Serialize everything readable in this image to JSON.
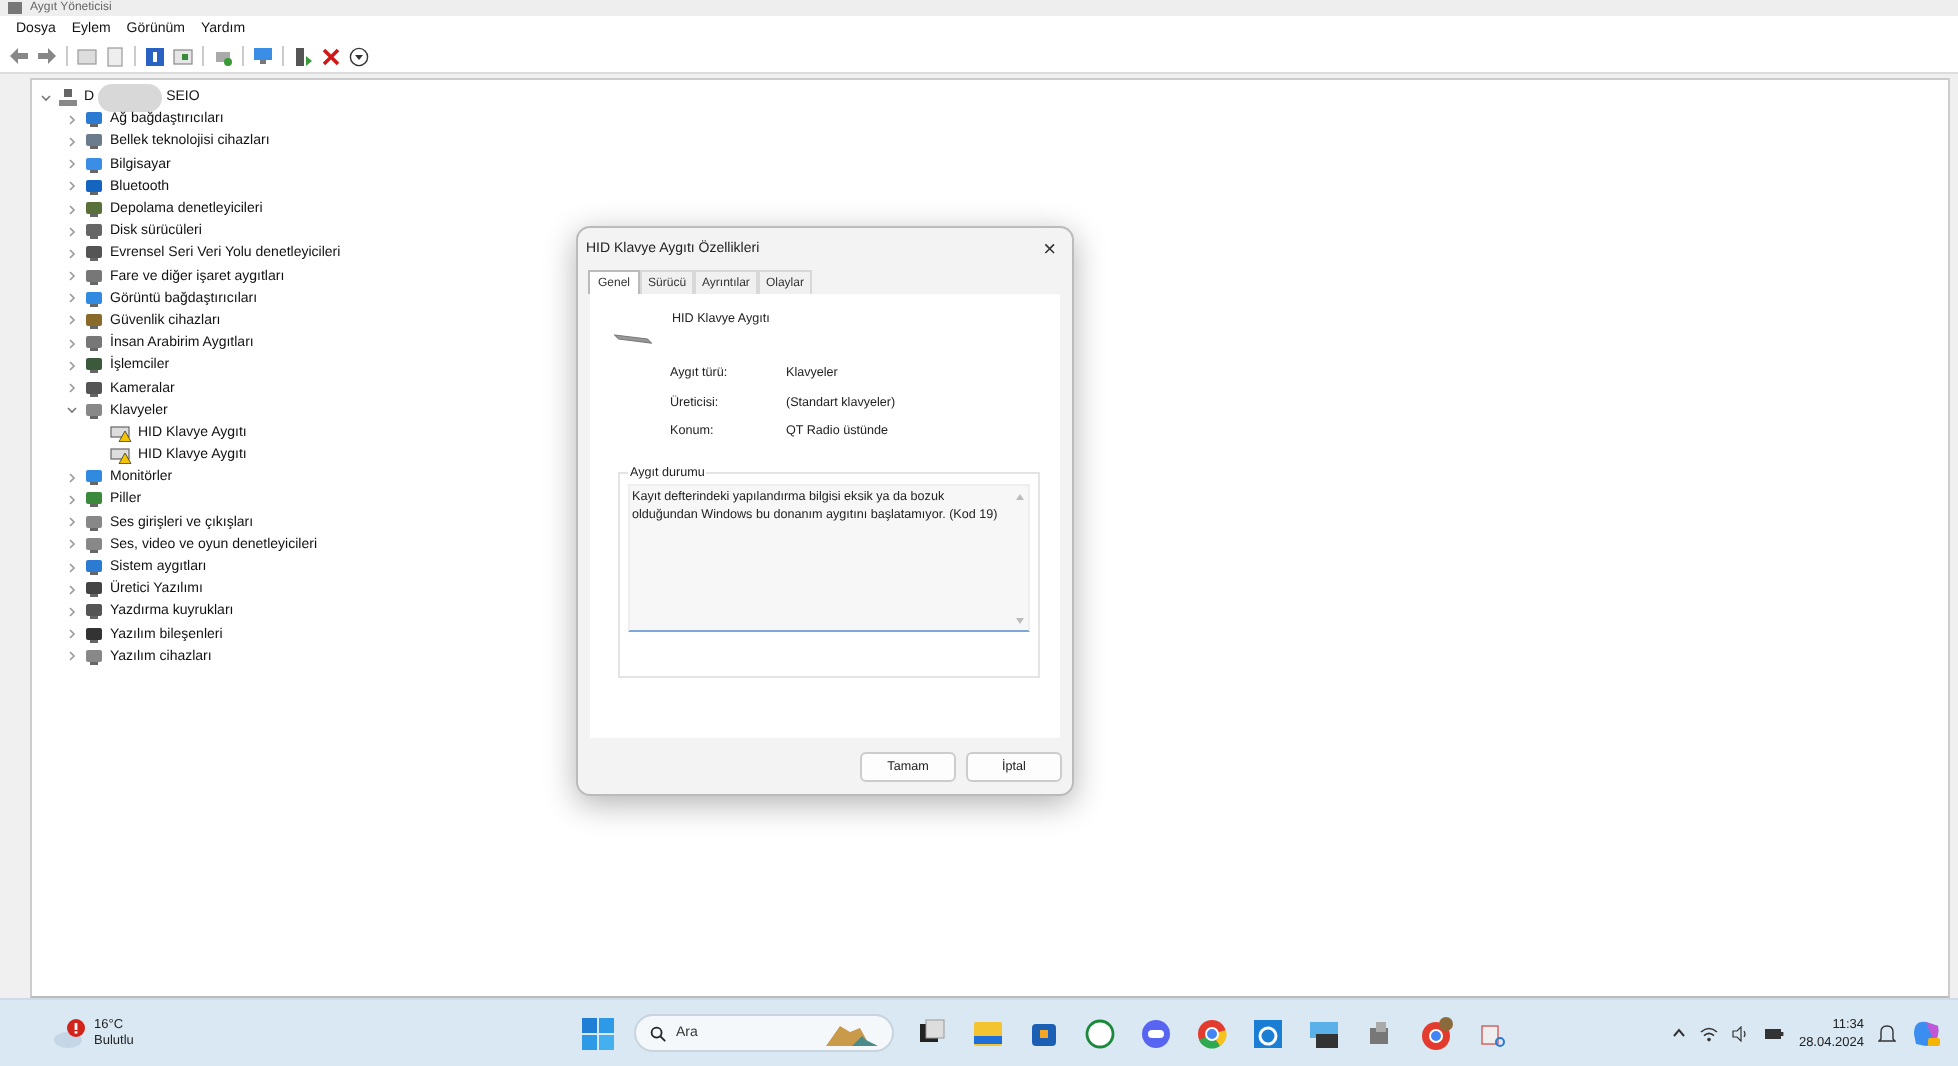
{
  "window": {
    "title": "Aygıt Yöneticisi",
    "menu": [
      "Dosya",
      "Eylem",
      "Görünüm",
      "Yardım"
    ]
  },
  "tree": {
    "root": {
      "label_start": "D",
      "label_end": "SEIO",
      "expanded": true
    },
    "items": [
      {
        "label": "Ağ bağdaştırıcıları",
        "expanded": false
      },
      {
        "label": "Bellek teknolojisi cihazları",
        "expanded": false
      },
      {
        "label": "Bilgisayar",
        "expanded": false
      },
      {
        "label": "Bluetooth",
        "expanded": false
      },
      {
        "label": "Depolama denetleyicileri",
        "expanded": false
      },
      {
        "label": "Disk sürücüleri",
        "expanded": false
      },
      {
        "label": "Evrensel Seri Veri Yolu denetleyicileri",
        "expanded": false
      },
      {
        "label": "Fare ve diğer işaret aygıtları",
        "expanded": false
      },
      {
        "label": "Görüntü bağdaştırıcıları",
        "expanded": false
      },
      {
        "label": "Güvenlik cihazları",
        "expanded": false
      },
      {
        "label": "İnsan Arabirim Aygıtları",
        "expanded": false
      },
      {
        "label": "İşlemciler",
        "expanded": false
      },
      {
        "label": "Kameralar",
        "expanded": false
      },
      {
        "label": "Klavyeler",
        "expanded": true,
        "children": [
          {
            "label": "HID Klavye Aygıtı",
            "warning": true
          },
          {
            "label": "HID Klavye Aygıtı",
            "warning": true
          }
        ]
      },
      {
        "label": "Monitörler",
        "expanded": false
      },
      {
        "label": "Piller",
        "expanded": false
      },
      {
        "label": "Ses girişleri ve çıkışları",
        "expanded": false
      },
      {
        "label": "Ses, video ve oyun denetleyicileri",
        "expanded": false
      },
      {
        "label": "Sistem aygıtları",
        "expanded": false
      },
      {
        "label": "Üretici Yazılımı",
        "expanded": false
      },
      {
        "label": "Yazdırma kuyrukları",
        "expanded": false
      },
      {
        "label": "Yazılım bileşenleri",
        "expanded": false
      },
      {
        "label": "Yazılım cihazları",
        "expanded": false
      }
    ]
  },
  "dialog": {
    "title": "HID Klavye Aygıtı Özellikleri",
    "close": "×",
    "tabs": [
      {
        "label": "Genel",
        "selected": true
      },
      {
        "label": "Sürücü",
        "selected": false
      },
      {
        "label": "Ayrıntılar",
        "selected": false
      },
      {
        "label": "Olaylar",
        "selected": false
      }
    ],
    "device_name": "HID Klavye Aygıtı",
    "fields": [
      {
        "label": "Aygıt türü:",
        "value": "Klavyeler"
      },
      {
        "label": "Üreticisi:",
        "value": "(Standart klavyeler)"
      },
      {
        "label": "Konum:",
        "value": "QT Radio üstünde"
      }
    ],
    "status_group": "Aygıt durumu",
    "status_text": "Kayıt defterindeki yapılandırma bilgisi eksik ya da bozuk olduğundan Windows bu donanım aygıtını başlatamıyor. (Kod 19)",
    "buttons": [
      "Tamam",
      "İptal"
    ]
  },
  "taskbar": {
    "temperature": "16°C",
    "weather": "Bulutlu",
    "search_placeholder": "Ara",
    "time": "11:34",
    "date": "28.04.2024"
  }
}
